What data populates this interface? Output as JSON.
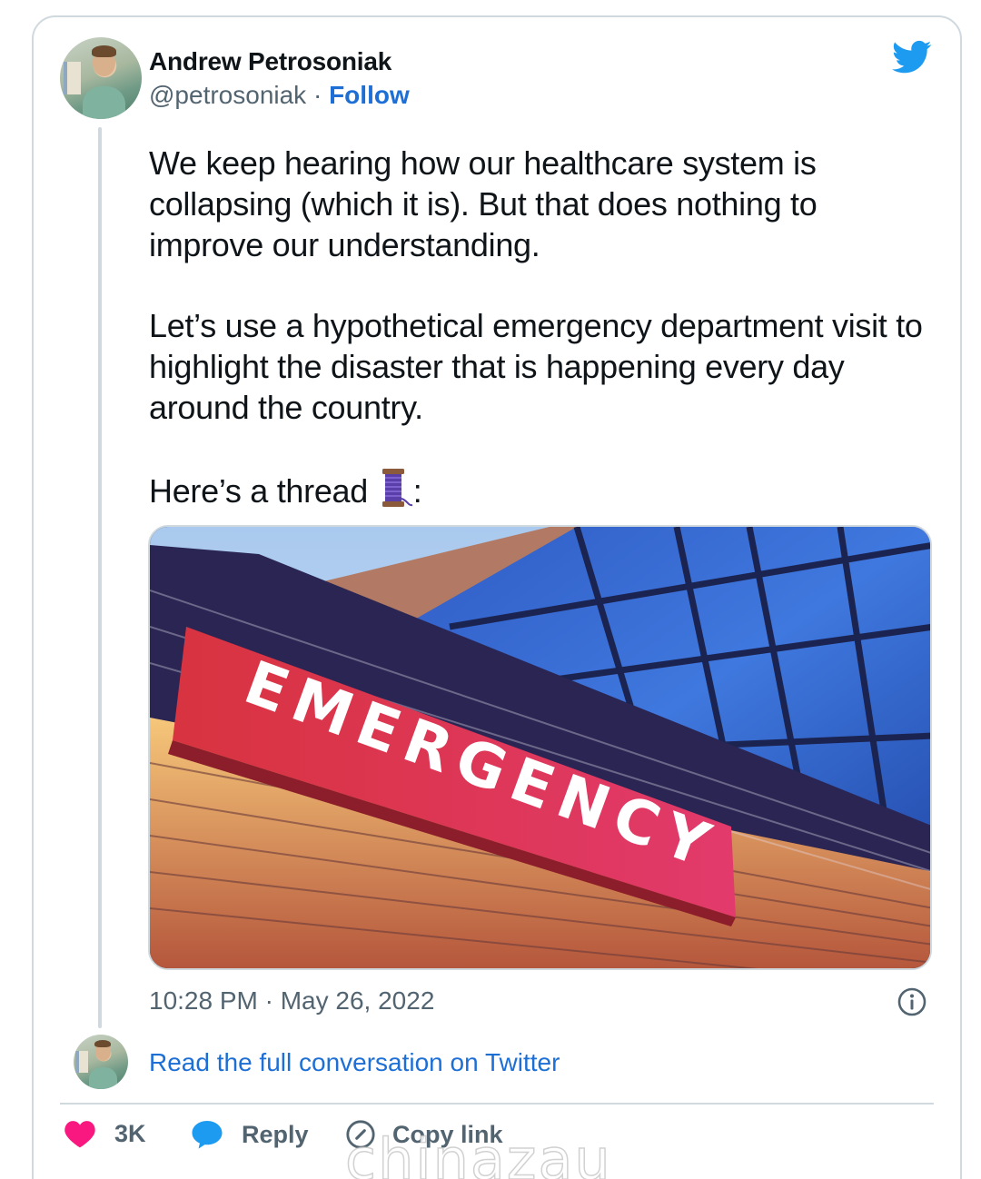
{
  "author": {
    "name": "Andrew Petrosoniak",
    "handle": "@petrosoniak",
    "separator": " · ",
    "follow_label": "Follow"
  },
  "tweet": {
    "paragraphs": [
      "We keep hearing how our healthcare system is collapsing (which it is). But that does nothing to improve our understanding.",
      "Let’s use a hypothetical emergency department visit to highlight the disaster that is happening every day around the country."
    ],
    "thread_prefix": "Here’s a thread ",
    "thread_suffix": ":",
    "thread_emoji": "spool-of-thread-icon"
  },
  "media": {
    "sign_text": "EMERGENCY"
  },
  "timestamp": "10:28 PM · May 26, 2022",
  "read_full_label": "Read the full conversation on Twitter",
  "actions": {
    "like_count": "3K",
    "reply_label": "Reply",
    "copy_label": "Copy link"
  },
  "watermark": "chinazau",
  "colors": {
    "twitter_blue": "#1d9bf0",
    "link_blue": "#1d6fd6",
    "like_red": "#f91880",
    "border": "#cfd9de",
    "secondary_text": "#536471"
  }
}
